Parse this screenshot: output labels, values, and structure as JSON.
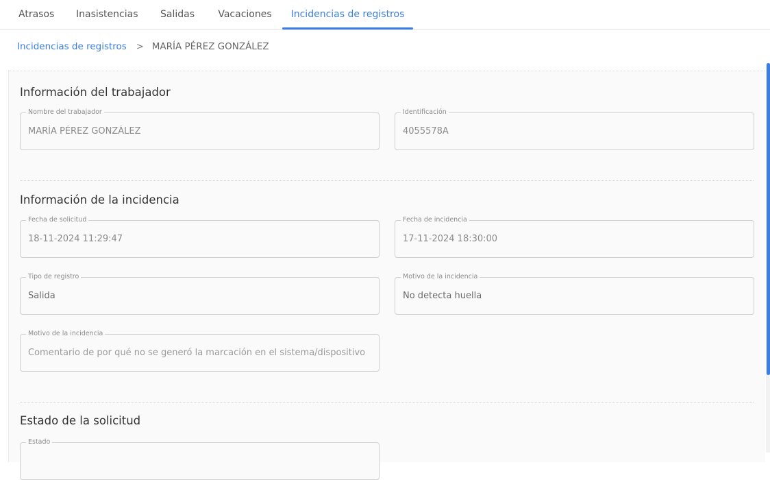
{
  "tabs": [
    {
      "label": "Atrasos"
    },
    {
      "label": "Inasistencias"
    },
    {
      "label": "Salidas"
    },
    {
      "label": "Vacaciones"
    },
    {
      "label": "Incidencias de registros",
      "active": true
    }
  ],
  "breadcrumb": {
    "parent": "Incidencias de registros",
    "separator": ">",
    "current": "MARÍA PÉREZ GONZÁLEZ"
  },
  "worker_section": {
    "title": "Información del trabajador",
    "name": {
      "label": "Nombre del trabajador",
      "value": "MARÍA PÉREZ GONZÁLEZ"
    },
    "id": {
      "label": "Identificación",
      "value": "4055578A"
    }
  },
  "incident_section": {
    "title": "Información de la incidencia",
    "request_date": {
      "label": "Fecha de solicitud",
      "value": "18-11-2024 11:29:47"
    },
    "incident_date": {
      "label": "Fecha de incidencia",
      "value": "17-11-2024 18:30:00"
    },
    "record_type": {
      "label": "Tipo de registro",
      "value": "Salida"
    },
    "reason": {
      "label": "Motivo de la incidencia",
      "value": "No detecta huella"
    },
    "comment": {
      "label": "Motivo de la incidencia",
      "placeholder": "Comentario de por qué no se generó la marcación en el sistema/dispositivo"
    }
  },
  "status_section": {
    "title": "Estado de la solicitud",
    "status": {
      "label": "Estado",
      "value": ""
    }
  },
  "colors": {
    "accent": "#3b7de0",
    "card_bg": "#fafafa",
    "border": "#cfcfcf"
  }
}
